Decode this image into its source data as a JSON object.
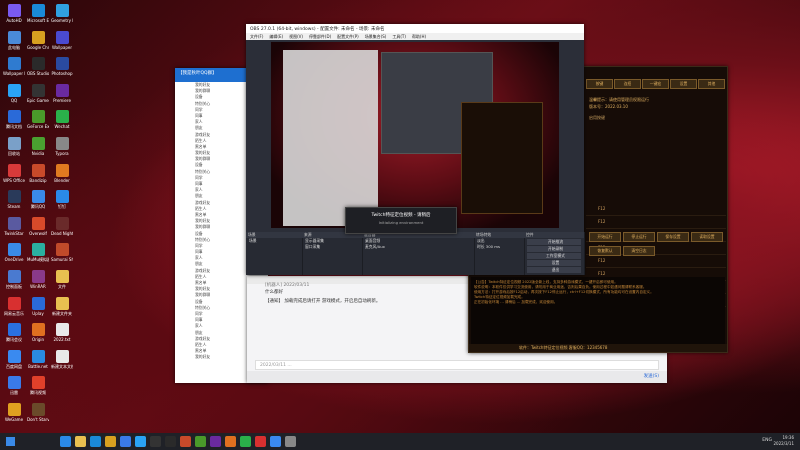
{
  "desktop": {
    "icons": [
      {
        "label": "AutoHD",
        "color": "#7a5af0"
      },
      {
        "label": "此电脑",
        "color": "#4a8ad8"
      },
      {
        "label": "Wallpaper Engine",
        "color": "#2f7bd0"
      },
      {
        "label": "QQ",
        "color": "#2aa3f5"
      },
      {
        "label": "腾讯文档",
        "color": "#2a6ad8"
      },
      {
        "label": "回收站",
        "color": "#7aa0c8"
      },
      {
        "label": "WPS Office",
        "color": "#d83a3a"
      },
      {
        "label": "Steam",
        "color": "#2a3a5a"
      },
      {
        "label": "TwinkStar",
        "color": "#5a5aa0"
      },
      {
        "label": "OneDrive",
        "color": "#3a8ae8"
      },
      {
        "label": "控制面板",
        "color": "#4a7ad0"
      },
      {
        "label": "网易云音乐",
        "color": "#d83030"
      },
      {
        "label": "腾讯会议",
        "color": "#2a70e0"
      },
      {
        "label": "百度网盘",
        "color": "#3a8af0"
      },
      {
        "label": "迅雷",
        "color": "#3a7ae8"
      },
      {
        "label": "WeGame",
        "color": "#e0a020"
      },
      {
        "label": "Microsoft Edge",
        "color": "#1a8ad8"
      },
      {
        "label": "Google Chrome",
        "color": "#d8a020"
      },
      {
        "label": "OBS Studio",
        "color": "#2a2a2a"
      },
      {
        "label": "Epic Games",
        "color": "#333"
      },
      {
        "label": "GeForce Experience",
        "color": "#4a9a2a"
      },
      {
        "label": "Nvidia",
        "color": "#4aa030"
      },
      {
        "label": "Bandizip",
        "color": "#c84a2a"
      },
      {
        "label": "腾讯QQ",
        "color": "#3a8ae8"
      },
      {
        "label": "Overwolf",
        "color": "#d84a2a"
      },
      {
        "label": "MuMu模拟器",
        "color": "#2ab0a0"
      },
      {
        "label": "WinRAR",
        "color": "#8a3a8a"
      },
      {
        "label": "Uplay",
        "color": "#2a6ad8"
      },
      {
        "label": "Origin",
        "color": "#e07020"
      },
      {
        "label": "Battle.net",
        "color": "#2a8ae0"
      },
      {
        "label": "腾讯视频",
        "color": "#e0402a"
      },
      {
        "label": "Don't Starve Together",
        "color": "#6a4a2a"
      },
      {
        "label": "Geometry Dash",
        "color": "#30a0e0"
      },
      {
        "label": "Wallpaper",
        "color": "#4a4ad0"
      },
      {
        "label": "Photoshop",
        "color": "#2a4aa0"
      },
      {
        "label": "Premiere",
        "color": "#6a2aa0"
      },
      {
        "label": "Wechat",
        "color": "#2ab04a"
      },
      {
        "label": "Typora",
        "color": "#888"
      },
      {
        "label": "Blender",
        "color": "#e07a20"
      },
      {
        "label": "钉钉",
        "color": "#2a8ae8"
      },
      {
        "label": "Dead Night Tour Games",
        "color": "#6a2a2a"
      },
      {
        "label": "Samurai Shodown",
        "color": "#c04a2a"
      },
      {
        "label": "文件",
        "color": "#e8c050"
      },
      {
        "label": "新建文件夹",
        "color": "#e8c050"
      },
      {
        "label": "2022.txt",
        "color": "#e8e8e8"
      },
      {
        "label": "新建文本文档",
        "color": "#e8e8e8"
      }
    ]
  },
  "qq_window": {
    "title": "【我是秋叶QQ群】",
    "groups": [
      "我的好友",
      "我的群聊",
      "设备",
      "特别关心",
      "同学",
      "同事",
      "家人",
      "朋友",
      "游戏好友",
      "陌生人",
      "黑名单"
    ]
  },
  "obs": {
    "title": "OBS 27.0.1 (64-bit, windows) - 配置文件: 未命名 - 场景: 未命名",
    "menu": [
      "文件(F)",
      "编辑(E)",
      "视图(V)",
      "停靠部件(D)",
      "配置文件(P)",
      "场景集合(S)",
      "工具(T)",
      "帮助(H)"
    ],
    "docks": [
      {
        "title": "场景",
        "items": [
          "场景"
        ]
      },
      {
        "title": "来源",
        "items": [
          "显示器采集",
          "窗口采集"
        ]
      },
      {
        "title": "混音器",
        "items": [
          "桌面音频",
          "麦克风/Aux"
        ]
      },
      {
        "title": "转场特效",
        "items": [
          "淡出",
          "时长 300 ms"
        ]
      },
      {
        "title": "控件",
        "items": [
          "开始推流",
          "开始录制",
          "工作室模式",
          "设置",
          "退出"
        ]
      }
    ]
  },
  "modal": {
    "title": "Twitch特征定位视频 - 请稍后",
    "subtitle": "Initializing environment"
  },
  "chat_window": {
    "sender": "[机器人] 2022/03/11",
    "message1": "什么都好",
    "message2": "【通知】 加载完成后请打开 游戏模式，开启后自动刷新。",
    "input_placeholder": "2022/03/11 ...",
    "send_label": "发送(S)"
  },
  "game_helper": {
    "tabs": [
      "按键",
      "连招",
      "一键宏",
      "设置",
      "其他"
    ],
    "notice_1": "温馨提示：请使用管理员权限运行",
    "notice_2": "版本号：2022.03.10",
    "check_label": "启用按键",
    "keys": [
      "F12",
      "F12",
      "F12",
      "F12",
      "F12",
      "F12",
      "ctrl+F12",
      "ctrl+F12"
    ],
    "buttons": [
      "开始运行",
      "停止运行",
      "保存设置",
      "读取设置",
      "恢复默认",
      "清空日志"
    ],
    "log": [
      "【公告】Twitch特征定位视频 2022版全新上线，支持多种游戏模式，一键开启即可使用。",
      "软件说明：本软件仅供学习交流使用，请勿用于商业用途，否则后果自负。使用过程中如遇问题请联系客服。",
      "使用方法：打开游戏后按F12启动，再次按下F12停止运行，ctrl+F12切换模式，所有功能均可在设置内自定义。",
      "Twitch特征定位视频加载完成。",
      "正在初始化环境 ... 请稍后 ... 加载完成，欢迎使用。"
    ],
    "footer": "软件：Twitch特征定位视频    客服QQ：12345678"
  },
  "taskbar": {
    "lang": "ENG",
    "time": "19:36",
    "date": "2022/3/11",
    "icons": [
      "#2a8ae8",
      "#e8c050",
      "#1a8ad8",
      "#d8a020",
      "#3a7ae8",
      "#2aa3f5",
      "#333",
      "#2a2a2a",
      "#c84a2a",
      "#4a9a2a",
      "#6a2aa0",
      "#e07020",
      "#2ab04a",
      "#d83030",
      "#3a8af0",
      "#888"
    ]
  }
}
